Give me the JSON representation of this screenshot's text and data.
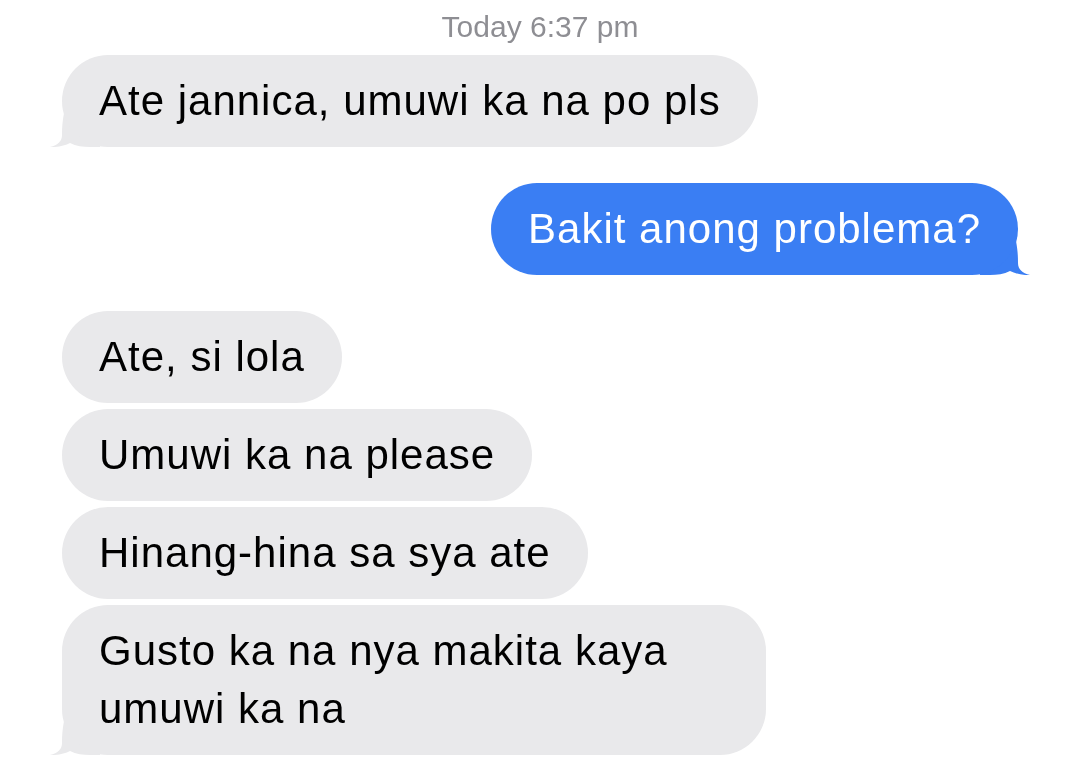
{
  "timestamp": "Today 6:37 pm",
  "messages": [
    {
      "kind": "incoming",
      "tail": true,
      "text": "Ate jannica, umuwi ka na po pls"
    },
    {
      "kind": "outgoing",
      "tail": true,
      "text": "Bakit anong problema?"
    },
    {
      "kind": "incoming",
      "tail": false,
      "text": "Ate, si lola"
    },
    {
      "kind": "incoming",
      "tail": false,
      "text": "Umuwi ka na please"
    },
    {
      "kind": "incoming",
      "tail": false,
      "text": "Hinang-hina sa sya ate"
    },
    {
      "kind": "incoming",
      "tail": true,
      "text": "Gusto ka na nya makita kaya umuwi ka na"
    }
  ]
}
